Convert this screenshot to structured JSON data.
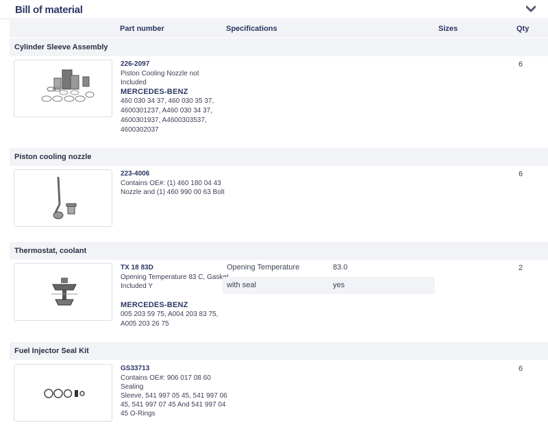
{
  "panel": {
    "title": "Bill of material",
    "collapse_icon": "chevron-down-icon"
  },
  "columns": {
    "part_number": "Part number",
    "specifications": "Specifications",
    "sizes": "Sizes",
    "qty": "Qty"
  },
  "groups": [
    {
      "title": "Cylinder Sleeve Assembly",
      "image_icon": "cylinder-sleeve-kit-icon",
      "part_number": "226-2097",
      "description": "Piston Cooling Nozzle not Included",
      "brand": "MERCEDES-BENZ",
      "oe_lines": [
        "460 030 34 37, 460 030 35 37,",
        "4600301237, A460 030 34 37,",
        "4600301937, A4600303537,",
        "4600302037"
      ],
      "qty": "6"
    },
    {
      "title": "Piston cooling nozzle",
      "image_icon": "cooling-nozzle-icon",
      "part_number": "223-4006",
      "description_lines": [
        "Contains OE#: (1) 460 180 04 43",
        "Nozzle and (1) 460 990 00 63 Bolt"
      ],
      "qty": "6"
    },
    {
      "title": "Thermostat, coolant",
      "image_icon": "thermostat-icon",
      "part_number": "TX 18 83D",
      "description_lines": [
        "Opening Temperature 83 C, Gasket",
        "Included Y"
      ],
      "brand": "MERCEDES-BENZ",
      "oe_lines": [
        "005 203 59 75, A004 203 83 75,",
        "A005 203 26 75"
      ],
      "specs": [
        {
          "label": "Opening Temperature",
          "value": "83.0"
        },
        {
          "label": "with seal",
          "value": "yes"
        }
      ],
      "qty": "2"
    },
    {
      "title": "Fuel Injector Seal Kit",
      "image_icon": "seal-kit-icon",
      "part_number": "GS33713",
      "description_lines": [
        "Contains OE#: 906 017 08 60 Sealing",
        "Sleeve, 541 997 05 45, 541 997 06",
        "45, 541 997 07 45 And 541 997 04",
        "45 O-Rings"
      ],
      "qty": "6"
    }
  ]
}
